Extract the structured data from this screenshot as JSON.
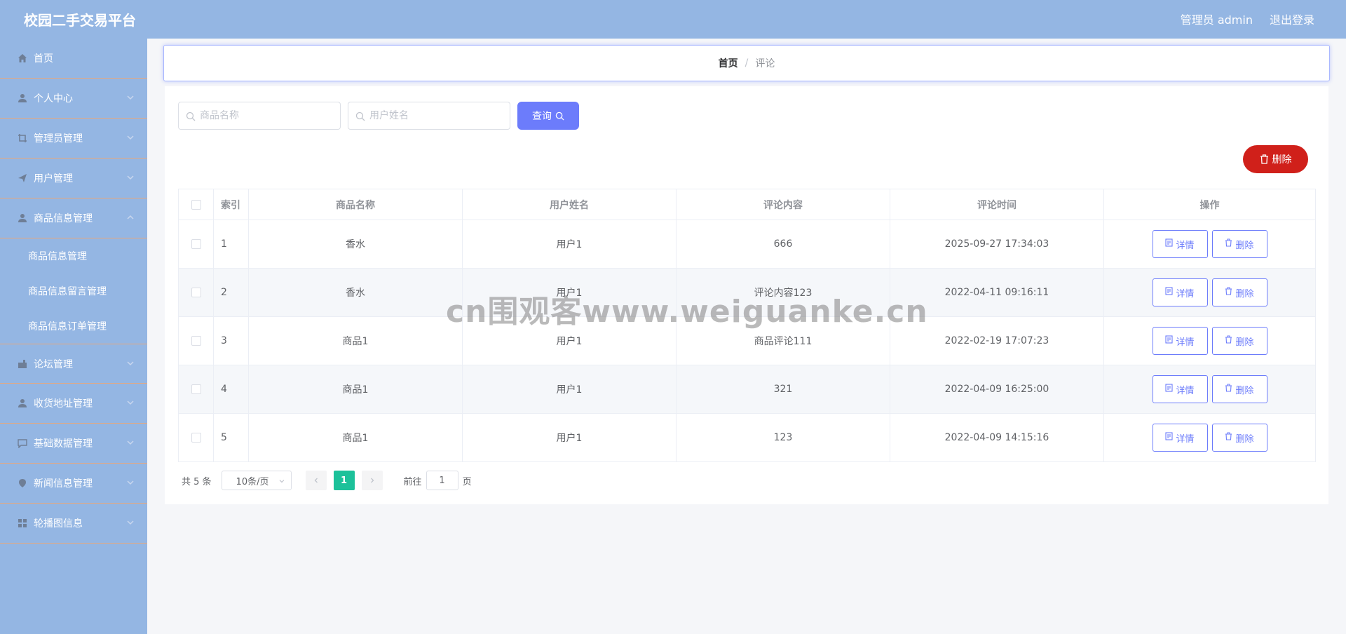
{
  "app": {
    "title": "校园二手交易平台",
    "user": "管理员 admin",
    "logout": "退出登录"
  },
  "sidebar": {
    "items": [
      {
        "label": "首页",
        "icon": "home-icon"
      },
      {
        "label": "个人中心",
        "icon": "user-icon"
      },
      {
        "label": "管理员管理",
        "icon": "crop-icon"
      },
      {
        "label": "用户管理",
        "icon": "send-icon"
      },
      {
        "label": "商品信息管理",
        "icon": "user-icon"
      },
      {
        "label": "论坛管理",
        "icon": "message-icon"
      },
      {
        "label": "收货地址管理",
        "icon": "user-icon"
      },
      {
        "label": "基础数据管理",
        "icon": "chat-icon"
      },
      {
        "label": "新闻信息管理",
        "icon": "location-icon"
      },
      {
        "label": "轮播图信息",
        "icon": "grid-icon"
      }
    ],
    "subitems": [
      "商品信息管理",
      "商品信息留言管理",
      "商品信息订单管理"
    ]
  },
  "breadcrumb": {
    "home": "首页",
    "separator": "/",
    "current": "评论"
  },
  "search": {
    "product_placeholder": "商品名称",
    "user_placeholder": "用户姓名",
    "query_label": "查询",
    "delete_label": "删除"
  },
  "table": {
    "headers": {
      "index": "索引",
      "product": "商品名称",
      "user": "用户姓名",
      "content": "评论内容",
      "time": "评论时间",
      "ops": "操作"
    },
    "detail_label": "详情",
    "delete_label": "删除",
    "rows": [
      {
        "index": "1",
        "product": "香水",
        "user": "用户1",
        "content": "666",
        "time": "2025-09-27 17:34:03"
      },
      {
        "index": "2",
        "product": "香水",
        "user": "用户1",
        "content": "评论内容123",
        "time": "2022-04-11 09:16:11"
      },
      {
        "index": "3",
        "product": "商品1",
        "user": "用户1",
        "content": "商品评论111",
        "time": "2022-02-19 17:07:23"
      },
      {
        "index": "4",
        "product": "商品1",
        "user": "用户1",
        "content": "321",
        "time": "2022-04-09 16:25:00"
      },
      {
        "index": "5",
        "product": "商品1",
        "user": "用户1",
        "content": "123",
        "time": "2022-04-09 14:15:16"
      }
    ]
  },
  "pagination": {
    "total": "共 5 条",
    "page_size": "10条/页",
    "current_page": "1",
    "goto_prefix": "前往",
    "goto_value": "1",
    "goto_suffix": "页"
  },
  "watermark": "cn围观客www.weiguanke.cn",
  "colors": {
    "primary": "#6c7cfb",
    "danger": "#d0201a",
    "sidebar": "#94b6e3",
    "page_active": "#1cc19a"
  }
}
